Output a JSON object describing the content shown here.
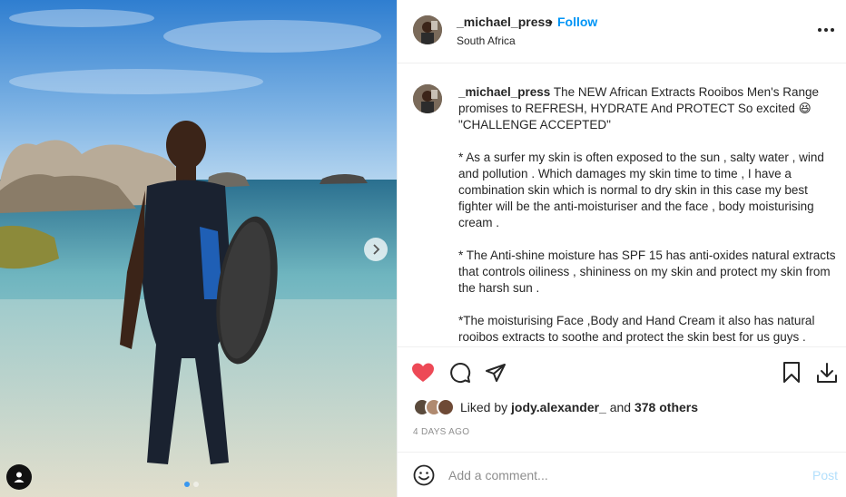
{
  "post": {
    "username": "_michael_press",
    "follow_label": "Follow",
    "separator": "•",
    "location": "South Africa",
    "more_icon": "more-options-icon"
  },
  "caption": {
    "username": "_michael_press",
    "line1": "The NEW African Extracts Rooibos Men's Range promises to REFRESH, HYDRATE And PROTECT So excited 😆 \"CHALLENGE ACCEPTED\"",
    "para2": "* As a surfer my skin is often exposed to the sun , salty water , wind and pollution . Which damages my skin time to time , I have a combination skin which is normal to dry skin in this case my best fighter will be the anti-moisturiser and the face , body moisturising cream .",
    "para3": "* The Anti-shine moisture has SPF 15 has anti-oxides natural extracts that controls oiliness , shininess on my skin and protect my skin from the harsh sun .",
    "para4": "*The moisturising Face ,Body and Hand Cream it also has natural rooibos extracts to soothe and protect the skin best for us guys ."
  },
  "likes": {
    "prefix": "Liked by",
    "user": "jody.alexander_",
    "middle": "and",
    "others": "378 others"
  },
  "timestamp": "4 DAYS AGO",
  "comment": {
    "placeholder": "Add a comment...",
    "post_label": "Post"
  },
  "carousel": {
    "slide_count": 2,
    "current_slide": 1
  },
  "colors": {
    "accent": "#0095f6",
    "like_red": "#ed4956",
    "post_disabled": "#b2dffc",
    "muted": "#8e8e8e"
  }
}
